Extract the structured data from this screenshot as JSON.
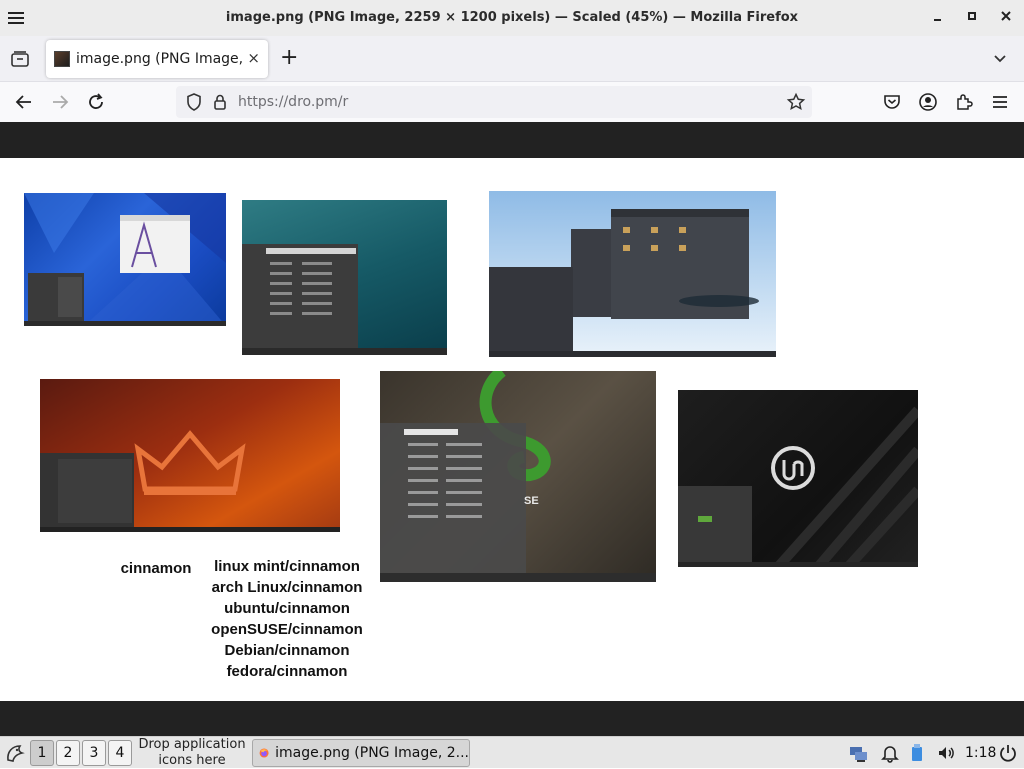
{
  "window": {
    "title": "image.png (PNG Image, 2259 × 1200 pixels) — Scaled (45%) — Mozilla Firefox"
  },
  "tab": {
    "label": "image.png (PNG Image, 2",
    "close_symbol": "×",
    "new_tab_symbol": "+"
  },
  "urlbar": {
    "url": "https://dro.pm/r"
  },
  "image": {
    "left_caption": "cinnamon",
    "distro_captions": [
      "linux mint/cinnamon",
      "arch Linux/cinnamon",
      "ubuntu/cinnamon",
      "openSUSE/cinnamon",
      "Debian/cinnamon",
      "fedora/cinnamon"
    ],
    "opensuse_overlay_text": "SE"
  },
  "taskbar": {
    "workspaces": [
      "1",
      "2",
      "3",
      "4"
    ],
    "active_workspace": "1",
    "drop_hint": "Drop application icons here",
    "task_label": "image.png (PNG Image, 2...",
    "clock": "1:18"
  },
  "colors": {
    "viewer_background": "#222222",
    "accent": "#0060df"
  }
}
